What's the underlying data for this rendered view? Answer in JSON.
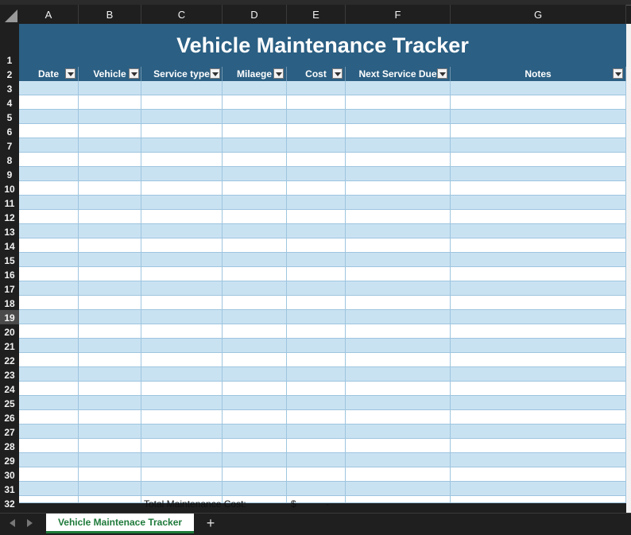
{
  "sheet": {
    "title": "Vehicle Maintenance Tracker",
    "columns": [
      "A",
      "B",
      "C",
      "D",
      "E",
      "F",
      "G"
    ],
    "headers": [
      "Date",
      "Vehicle",
      "Service type",
      "Milaege",
      "Cost",
      "Next Service Due",
      "Notes"
    ],
    "row_numbers": [
      "1",
      "2",
      "3",
      "4",
      "5",
      "6",
      "7",
      "8",
      "9",
      "10",
      "11",
      "12",
      "13",
      "14",
      "15",
      "16",
      "17",
      "18",
      "19",
      "20",
      "21",
      "22",
      "23",
      "24",
      "25",
      "26",
      "27",
      "28",
      "29",
      "30",
      "31",
      "32"
    ],
    "selected_row": "19",
    "total_label": "Total Maintenance Cost:",
    "total_currency": "$",
    "total_value": "-"
  },
  "tabs": {
    "active": "Vehicle Maintenace Tracker",
    "add": "+"
  },
  "colors": {
    "header_fill": "#2b5f83",
    "band_fill": "#c9e2f2",
    "tab_text": "#1e7a3a"
  }
}
